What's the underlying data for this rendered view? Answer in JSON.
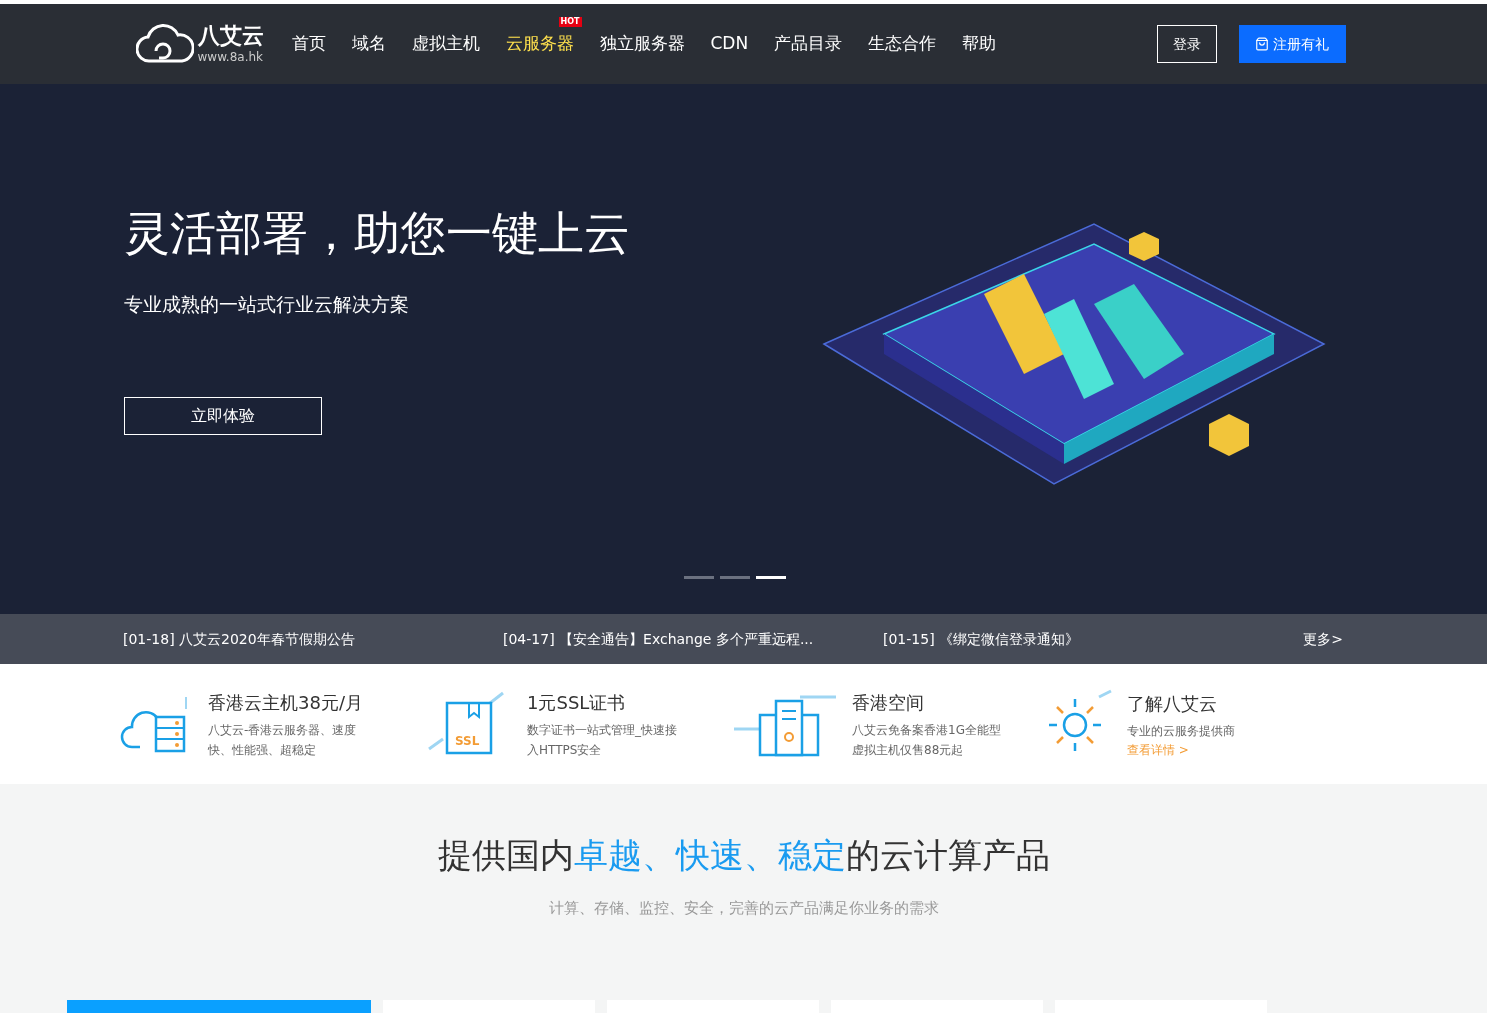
{
  "header": {
    "logo": {
      "name": "八艾云",
      "url": "www.8a.hk"
    },
    "nav": [
      {
        "label": "首页",
        "selected": false
      },
      {
        "label": "域名",
        "selected": false
      },
      {
        "label": "虚拟主机",
        "selected": false
      },
      {
        "label": "云服务器",
        "selected": true,
        "badge": "HOT"
      },
      {
        "label": "独立服务器",
        "selected": false
      },
      {
        "label": "CDN",
        "selected": false
      },
      {
        "label": "产品目录",
        "selected": false
      },
      {
        "label": "生态合作",
        "selected": false
      },
      {
        "label": "帮助",
        "selected": false
      }
    ],
    "login": "登录",
    "register": "注册有礼"
  },
  "hero": {
    "title": "灵活部署，助您一键上云",
    "subtitle": "专业成熟的一站式行业云解决方案",
    "cta": "立即体验",
    "dots": [
      {
        "selected": false
      },
      {
        "selected": false
      },
      {
        "selected": true
      }
    ]
  },
  "news": {
    "items": [
      "[01-18] 八艾云2020年春节假期公告",
      "[04-17] 【安全通告】Exchange 多个严重远程...",
      "[01-15] 《绑定微信登录通知》"
    ],
    "more": "更多>"
  },
  "features": [
    {
      "kind": "cloud",
      "title": "香港云主机38元/月",
      "desc": "八艾云-香港云服务器、速度快、性能强、超稳定"
    },
    {
      "kind": "ssl",
      "title": "1元SSL证书",
      "desc": "数字证书一站式管理_快速接入HTTPS安全",
      "icon_text": "SSL"
    },
    {
      "kind": "building",
      "title": "香港空间",
      "desc": "八艾云免备案香港1G全能型虚拟主机仅售88元起"
    },
    {
      "kind": "sun",
      "title": "了解八艾云",
      "desc": "专业的云服务提供商",
      "link": "查看详情 >"
    }
  ],
  "section": {
    "heading": [
      {
        "text": "提供国内",
        "highlight": false
      },
      {
        "text": "卓越、快速、稳定",
        "highlight": true
      },
      {
        "text": "的云计算产品",
        "highlight": false
      }
    ],
    "subtitle": "计算、存储、监控、安全，完善的云产品满足你业务的需求"
  },
  "cards": [
    {
      "selected": true
    },
    {
      "selected": false
    },
    {
      "selected": false
    },
    {
      "selected": false
    },
    {
      "selected": false
    }
  ]
}
